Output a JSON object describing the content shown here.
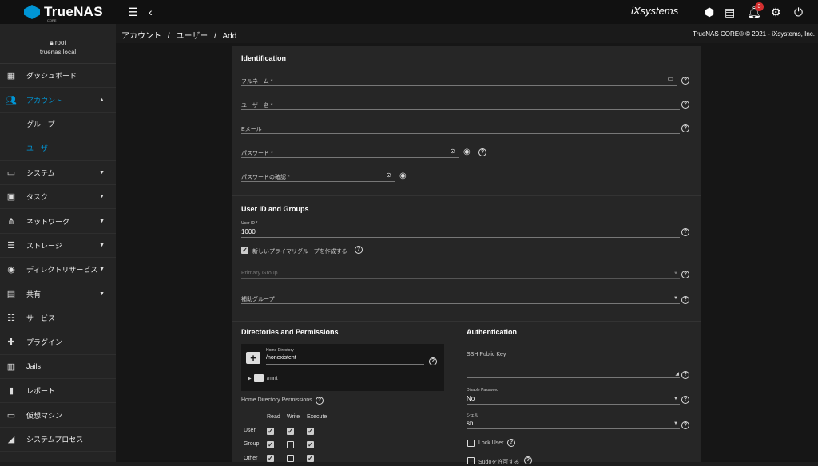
{
  "topbar": {
    "logo": "TrueNAS",
    "logo_sub": "CORE",
    "brand": "iXsystems",
    "notifications": "3"
  },
  "user": {
    "name": "root",
    "host": "truenas.local"
  },
  "sidebar": [
    {
      "label": "ダッシュボード",
      "icon": "dashboard-icon"
    },
    {
      "label": "アカウント",
      "icon": "people-icon",
      "active": true
    },
    {
      "label": "グループ",
      "sub": true
    },
    {
      "label": "ユーザー",
      "sub": true,
      "active": true
    },
    {
      "label": "システム",
      "icon": "computer-icon"
    },
    {
      "label": "タスク",
      "icon": "calendar-icon"
    },
    {
      "label": "ネットワーク",
      "icon": "network-icon"
    },
    {
      "label": "ストレージ",
      "icon": "storage-icon"
    },
    {
      "label": "ディレクトリサービス",
      "icon": "directory-icon"
    },
    {
      "label": "共有",
      "icon": "share-icon"
    },
    {
      "label": "サービス",
      "icon": "tune-icon"
    },
    {
      "label": "プラグイン",
      "icon": "puzzle-icon"
    },
    {
      "label": "Jails",
      "icon": "jail-icon"
    },
    {
      "label": "レポート",
      "icon": "chart-icon"
    },
    {
      "label": "仮想マシン",
      "icon": "vm-icon"
    },
    {
      "label": "システムプロセス",
      "icon": "process-icon"
    }
  ],
  "breadcrumb": {
    "a": "アカウント",
    "b": "ユーザー",
    "c": "Add",
    "sep": "/"
  },
  "copyright": "TrueNAS CORE® © 2021 - iXsystems, Inc.",
  "identification": {
    "title": "Identification",
    "fullname": "フルネーム *",
    "username": "ユーザー名 *",
    "email": "Eメール",
    "password": "パスワード *",
    "password_confirm": "パスワードの確認 *"
  },
  "userid": {
    "title": "User ID and Groups",
    "uid_label": "User ID *",
    "uid_value": "1000",
    "create_group": "新しいプライマリグループを作成する",
    "primary_group": "Primary Group",
    "aux_groups": "補助グループ"
  },
  "directories": {
    "title": "Directories and Permissions",
    "home_label": "Home Directory",
    "home_value": "/nonexistent",
    "tree_item": "/mnt",
    "perm_title": "Home Directory Permissions",
    "cols": [
      "Read",
      "Write",
      "Execute"
    ],
    "rows": [
      "User",
      "Group",
      "Other"
    ]
  },
  "auth": {
    "title": "Authentication",
    "ssh": "SSH Public Key",
    "disable_pw_label": "Disable Password",
    "disable_pw_value": "No",
    "shell_label": "シェル",
    "shell_value": "sh",
    "lock_user": "Lock User",
    "sudo": "Sudoを許可する"
  }
}
